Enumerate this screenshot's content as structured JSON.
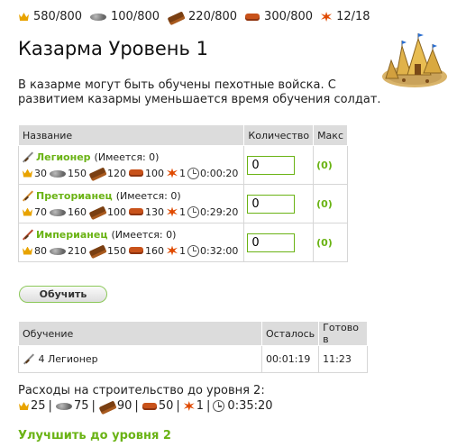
{
  "resources": [
    {
      "icon": "crop-icon",
      "value": "580/800"
    },
    {
      "icon": "iron-icon",
      "value": "100/800"
    },
    {
      "icon": "wood-icon",
      "value": "220/800"
    },
    {
      "icon": "clay-icon",
      "value": "300/800"
    },
    {
      "icon": "burst-icon",
      "value": "12/18"
    }
  ],
  "page": {
    "title": "Казарма Уровень 1",
    "description": "В казарме могут быть обучены пехотные войска. С развитием казармы уменьшается время обучения солдат."
  },
  "units_table": {
    "headers": {
      "name": "Название",
      "quantity": "Количество",
      "max": "Макс"
    },
    "rows": [
      {
        "name": "Легионер",
        "have": "(Имеется: 0)",
        "crop": "30",
        "iron": "150",
        "wood": "120",
        "clay": "100",
        "upkeep": "1",
        "time": "0:00:20",
        "quantity": "0",
        "max": "(0)",
        "icon": "sword-icon"
      },
      {
        "name": "Преторианец",
        "have": "(Имеется: 0)",
        "crop": "70",
        "iron": "160",
        "wood": "100",
        "clay": "130",
        "upkeep": "1",
        "time": "0:29:20",
        "quantity": "0",
        "max": "(0)",
        "icon": "sword-icon"
      },
      {
        "name": "Империанец",
        "have": "(Имеется: 0)",
        "crop": "80",
        "iron": "210",
        "wood": "150",
        "clay": "160",
        "upkeep": "1",
        "time": "0:32:00",
        "quantity": "0",
        "max": "(0)",
        "icon": "sword-icon"
      }
    ]
  },
  "train_button": "Обучить",
  "queue_table": {
    "headers": {
      "training": "Обучение",
      "remaining": "Осталось",
      "ready": "Готово в"
    },
    "rows": [
      {
        "unit": "4 Легионер",
        "remaining": "00:01:19",
        "ready": "11:23"
      }
    ]
  },
  "upgrade_costs": {
    "title": "Расходы на строительство до уровня 2:",
    "crop": "25",
    "iron": "75",
    "wood": "90",
    "clay": "50",
    "upkeep": "1",
    "time": "0:35:20"
  },
  "upgrade_link": "Улучшить до уровня 2",
  "colors": {
    "accent_green": "#6ab314",
    "header_gray": "#dcdcdc"
  }
}
